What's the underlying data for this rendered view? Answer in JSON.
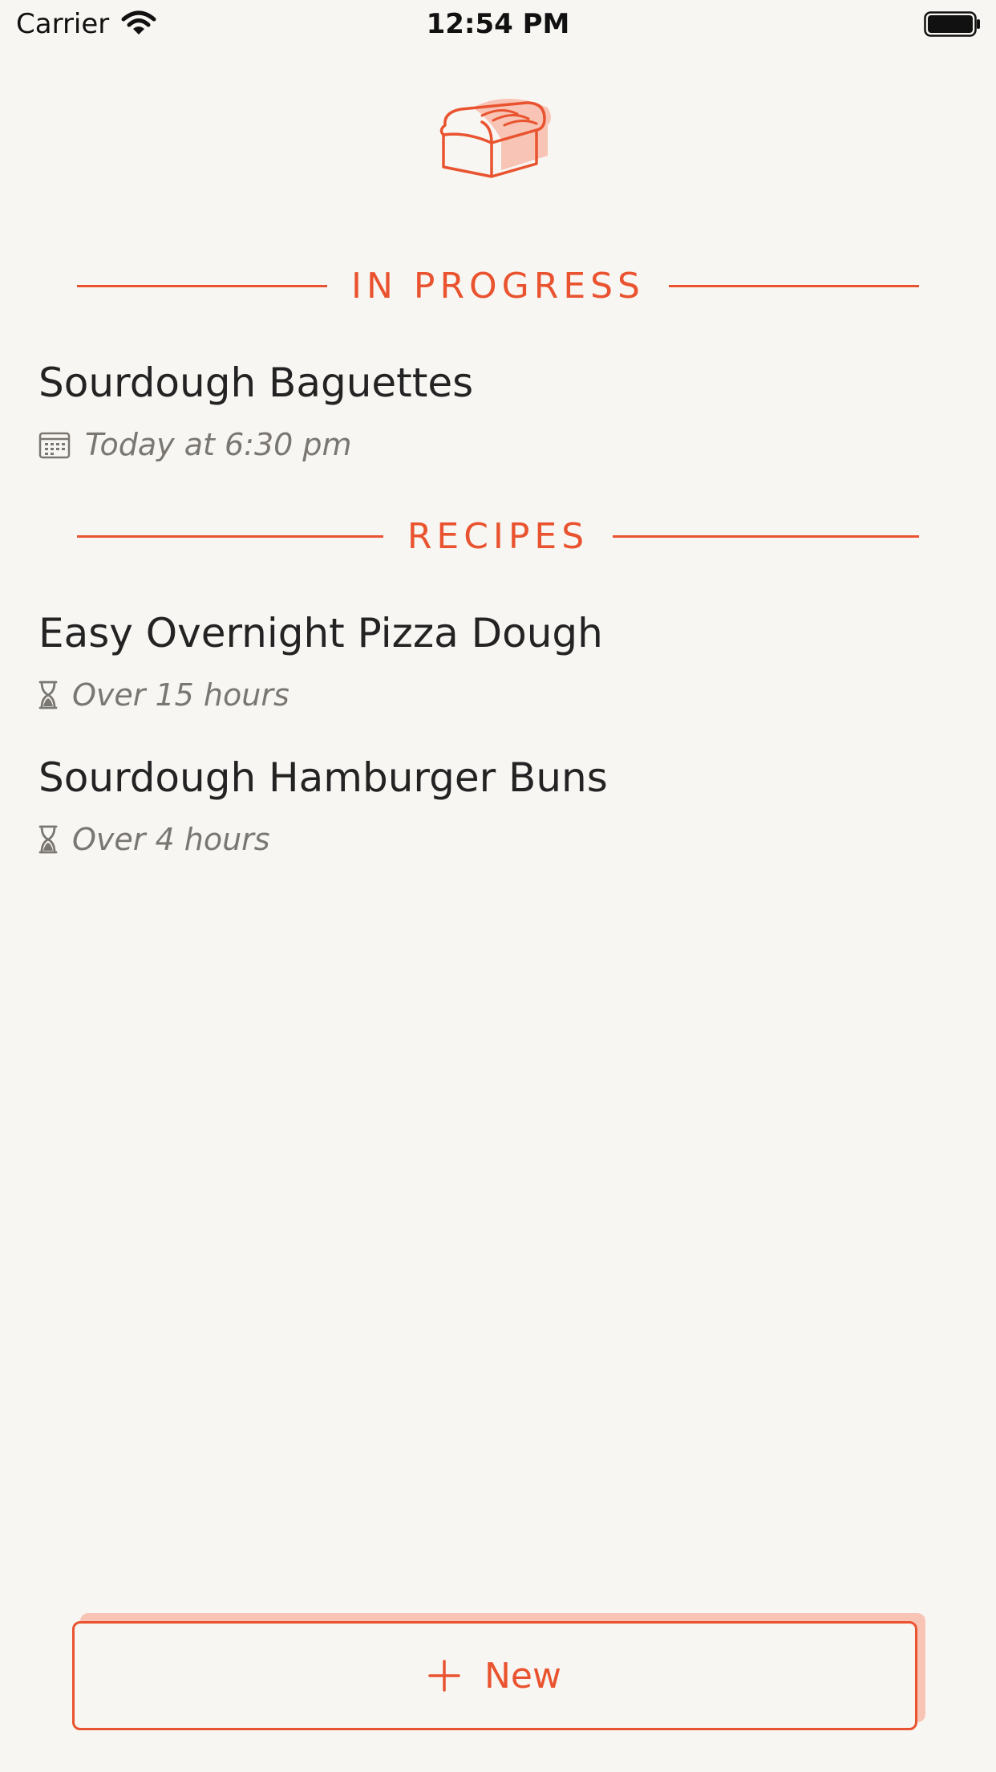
{
  "status_bar": {
    "carrier": "Carrier",
    "time": "12:54 PM"
  },
  "icons": {
    "logo": "bread-loaf-icon",
    "wifi": "wifi-icon",
    "battery": "battery-icon",
    "calendar": "calendar-icon",
    "timer": "hourglass-icon",
    "add": "plus-icon"
  },
  "colors": {
    "accent": "#e9532f",
    "accent_light": "#f8c4b6",
    "background": "#f8f6f2",
    "text": "#232323",
    "muted": "#7a7773"
  },
  "sections": {
    "in_progress": {
      "title": "IN PROGRESS",
      "items": [
        {
          "title": "Sourdough Baguettes",
          "meta": "Today at 6:30 pm"
        }
      ]
    },
    "recipes": {
      "title": "RECIPES",
      "items": [
        {
          "title": "Easy Overnight Pizza Dough",
          "meta": "Over 15 hours"
        },
        {
          "title": "Sourdough Hamburger Buns",
          "meta": "Over 4 hours"
        }
      ]
    }
  },
  "new_button": {
    "label": "New"
  }
}
